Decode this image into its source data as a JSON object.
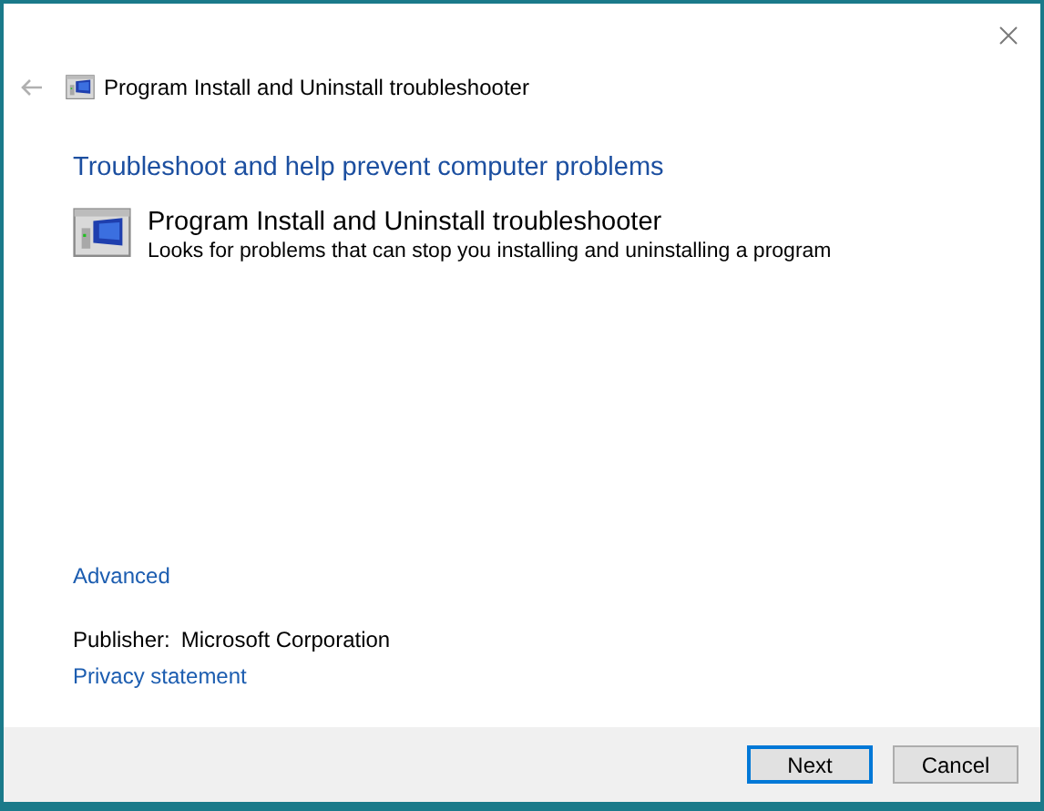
{
  "window": {
    "title": "Program Install and Uninstall troubleshooter"
  },
  "heading": "Troubleshoot and help prevent computer problems",
  "troubleshooter": {
    "name": "Program Install and Uninstall troubleshooter",
    "description": "Looks for problems that can stop you installing and uninstalling a program"
  },
  "advanced_link": "Advanced",
  "publisher": {
    "label": "Publisher:",
    "value": "Microsoft Corporation"
  },
  "privacy_link": "Privacy statement",
  "buttons": [
    {
      "label": "Next",
      "default": true
    },
    {
      "label": "Cancel",
      "default": false
    }
  ]
}
